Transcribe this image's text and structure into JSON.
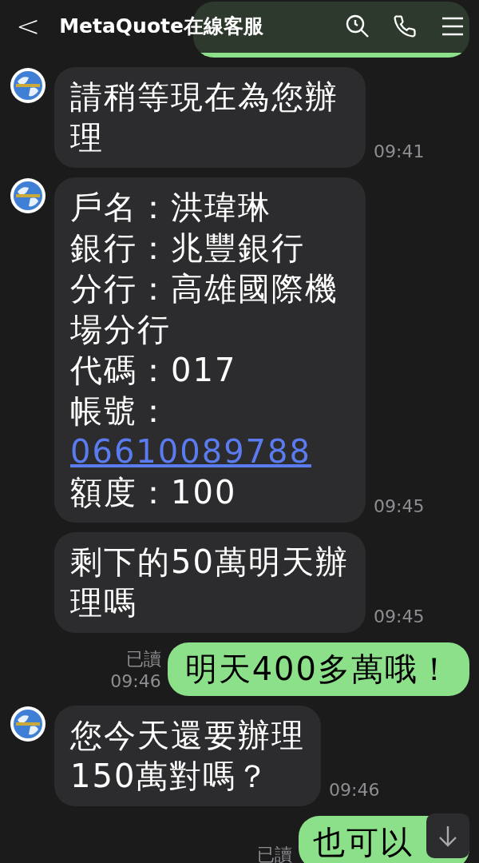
{
  "header": {
    "back": "<",
    "title": "MetaQuote在線客服"
  },
  "messages": [
    {
      "kind": "outgoing_hidden"
    },
    {
      "kind": "incoming",
      "avatar": true,
      "lines": [
        {
          "text": "請稍等現在為您辦理"
        }
      ],
      "time": "09:41"
    },
    {
      "kind": "incoming",
      "avatar": true,
      "lines": [
        {
          "text": "戶名：洪瑋琳"
        },
        {
          "text": "銀行：兆豐銀行"
        },
        {
          "text": "分行：高雄國際機場分行"
        },
        {
          "text": "代碼：017"
        },
        {
          "text": "帳號：",
          "link": "06610089788"
        },
        {
          "text": "額度：100"
        }
      ],
      "time": "09:45"
    },
    {
      "kind": "incoming",
      "avatar": false,
      "lines": [
        {
          "text": "剩下的50萬明天辦理嗎"
        }
      ],
      "time": "09:45"
    },
    {
      "kind": "outgoing",
      "read": "已讀",
      "lines": [
        {
          "text": "明天400多萬哦！"
        }
      ],
      "time": "09:46"
    },
    {
      "kind": "incoming",
      "avatar": true,
      "lines": [
        {
          "text": "您今天還要辦理"
        },
        {
          "text": "150萬對嗎？"
        }
      ],
      "time": "09:46"
    },
    {
      "kind": "outgoing",
      "read": "已讀",
      "lines": [
        {
          "text": "也可以"
        }
      ]
    }
  ]
}
